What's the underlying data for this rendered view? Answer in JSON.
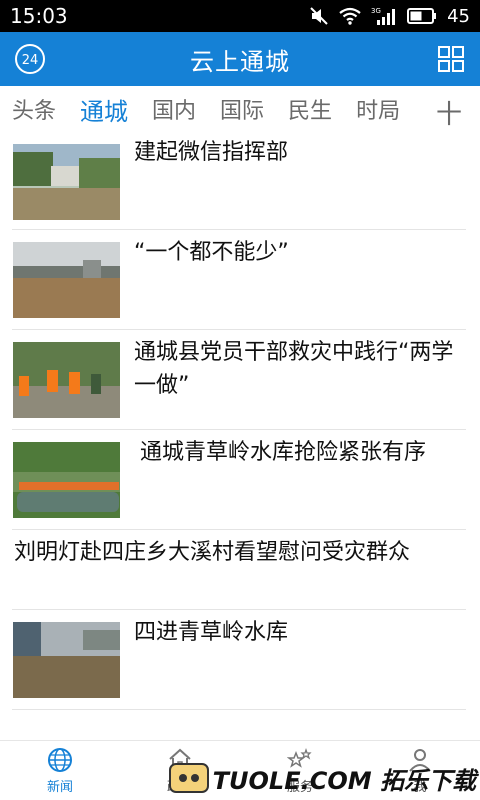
{
  "status": {
    "time": "15:03",
    "battery": "45",
    "network": "3G"
  },
  "app": {
    "title": "云上通城",
    "logo_text": "24"
  },
  "tabs": [
    "头条",
    "通城",
    "国内",
    "国际",
    "民生",
    "时局"
  ],
  "tab_add": "十",
  "news": [
    {
      "title": "建起微信指挥部",
      "thumb": "flood-town-icon"
    },
    {
      "title": "“一个都不能少”",
      "thumb": "flood-river-icon"
    },
    {
      "title": "通城县党员干部救灾中践行“两学一做”",
      "thumb": "rescue-workers-icon"
    },
    {
      "title": "通城青草岭水库抢险紧张有序",
      "thumb": "rescue-boat-icon"
    },
    {
      "title": "刘明灯赴四庄乡大溪村看望慰问受灾群众"
    },
    {
      "title": "四进青草岭水库",
      "thumb": "flooded-street-icon"
    }
  ],
  "bottom_nav": [
    {
      "label": "新闻",
      "icon": "globe-icon"
    },
    {
      "label": "政务",
      "icon": "house-icon"
    },
    {
      "label": "服务",
      "icon": "stars-icon"
    },
    {
      "label": "我",
      "icon": "person-icon"
    }
  ],
  "watermark": "TUOLE.COM 拓乐下载",
  "colors": {
    "brand": "#1581d6",
    "text": "#111111",
    "muted": "#6a6a6a"
  }
}
